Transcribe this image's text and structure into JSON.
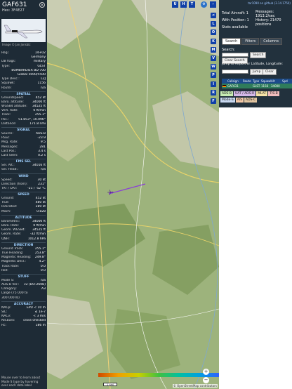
{
  "aircraft": {
    "callsign": "GAF631",
    "hex_label": "Hex:",
    "hex": "3F4E27",
    "photo_credit": "Image © Jan Jonsbiz"
  },
  "details": [
    {
      "type": "row",
      "label": "Reg.:",
      "value": "14+02"
    },
    {
      "type": "row",
      "label": "",
      "value": "Germany"
    },
    {
      "type": "row",
      "label": "DB flags:",
      "value": "military"
    },
    {
      "type": "row",
      "label": "Type:",
      "value": "GLST"
    },
    {
      "type": "row",
      "label": "",
      "value": "BOMBARDIER BD-700"
    },
    {
      "type": "row",
      "label": "",
      "value": "Global 5000/5500"
    },
    {
      "type": "row",
      "label": "Type Desc.:",
      "value": "L2J"
    },
    {
      "type": "row",
      "label": "Squawk:",
      "value": "1156"
    },
    {
      "type": "row",
      "label": "Route:",
      "value": "n/a"
    },
    {
      "type": "section",
      "label": "SPATIAL"
    },
    {
      "type": "row",
      "label": "Groundspeed:",
      "value": "452 kt"
    },
    {
      "type": "row",
      "label": "Baro. altitude:",
      "value": "34000 ft"
    },
    {
      "type": "row",
      "label": "WGS84 altitude:",
      "value": "34525 ft"
    },
    {
      "type": "row",
      "label": "Vert. Rate:",
      "value": "0 ft/min"
    },
    {
      "type": "row",
      "label": "Track:",
      "value": "255.1°"
    },
    {
      "type": "row",
      "label": "Pos.:",
      "value": "51.853°, 10.096°"
    },
    {
      "type": "row",
      "label": "Distance:",
      "value": "171.8 nmi"
    },
    {
      "type": "section",
      "label": "SIGNAL"
    },
    {
      "type": "row",
      "label": "Source:",
      "value": "ADS-B"
    },
    {
      "type": "row",
      "label": "RSSI:",
      "value": "-23.9"
    },
    {
      "type": "row",
      "label": "Msg. Rate:",
      "value": "9.5"
    },
    {
      "type": "row",
      "label": "Messages:",
      "value": "281"
    },
    {
      "type": "row",
      "label": "Last Pos.:",
      "value": "3.4 s"
    },
    {
      "type": "row",
      "label": "Last Seen:",
      "value": "0.2 s"
    },
    {
      "type": "section",
      "label": "FMS SEL"
    },
    {
      "type": "row",
      "label": "Sel. Alt.:",
      "value": "34016 ft"
    },
    {
      "type": "row",
      "label": "Sel. Head.:",
      "value": "n/a"
    },
    {
      "type": "section",
      "label": "WIND"
    },
    {
      "type": "row",
      "label": "Speed:",
      "value": "30 kt"
    },
    {
      "type": "row",
      "label": "Direction (from):",
      "value": "231°"
    },
    {
      "type": "row",
      "label": "TAT / OAT:",
      "value": "-21 / -52 °C"
    },
    {
      "type": "section",
      "label": "SPEED"
    },
    {
      "type": "row",
      "label": "Ground:",
      "value": "452 kt"
    },
    {
      "type": "row",
      "label": "True:",
      "value": "480 kt"
    },
    {
      "type": "row",
      "label": "Indicated:",
      "value": "289 kt"
    },
    {
      "type": "row",
      "label": "Mach:",
      "value": "0.828"
    },
    {
      "type": "section",
      "label": "ALTITUDE"
    },
    {
      "type": "row",
      "label": "Barometric:",
      "value": "34000 ft"
    },
    {
      "type": "row",
      "label": "Baro. Rate:",
      "value": "0 ft/min"
    },
    {
      "type": "row",
      "label": "Geom. WGS84:",
      "value": "34525 ft"
    },
    {
      "type": "row",
      "label": "Geom. Rate:",
      "value": "-32 ft/min"
    },
    {
      "type": "row",
      "label": "QNH:",
      "value": "1012.8 hPa"
    },
    {
      "type": "section",
      "label": "DIRECTION"
    },
    {
      "type": "row",
      "label": "Ground Track:",
      "value": "255.1°"
    },
    {
      "type": "row",
      "label": "True Heading:",
      "value": "253.8°"
    },
    {
      "type": "row",
      "label": "Magnetic Heading:",
      "value": "249.8°"
    },
    {
      "type": "row",
      "label": "Magnetic Decl.:",
      "value": "4.2°"
    },
    {
      "type": "row",
      "label": "Track Rate:",
      "value": "0.0"
    },
    {
      "type": "row",
      "label": "Roll:",
      "value": "0.0"
    },
    {
      "type": "section",
      "label": "STUFF"
    },
    {
      "type": "row",
      "label": "Mode S:",
      "value": "n/a"
    },
    {
      "type": "row",
      "label": "ADS-B Ver.:",
      "value": "v2 (DO-260B)"
    },
    {
      "type": "row",
      "label": "Category:",
      "value": "A3"
    },
    {
      "type": "row",
      "label": "Large (75 000 to",
      "value": ""
    },
    {
      "type": "row",
      "label": "300 000 lb)",
      "value": ""
    },
    {
      "type": "section",
      "label": "ACCURACY"
    },
    {
      "type": "row",
      "label": "NACp:",
      "value": "EPU < 10 m"
    },
    {
      "type": "row",
      "label": "SIL:",
      "value": "≤ 1e-7"
    },
    {
      "type": "row",
      "label": "NACv:",
      "value": "< 3 m/s"
    },
    {
      "type": "row",
      "label": "NICbaro:",
      "value": "cross-checked"
    },
    {
      "type": "row",
      "label": "Rc:",
      "value": "186 m"
    }
  ],
  "footer_text": "Mouse over to learn about Mode S type by hovering over each data label",
  "map": {
    "top_buttons": [
      "U",
      "H",
      "T"
    ],
    "side_buttons": [
      "<",
      "L",
      "O",
      "K",
      "M",
      "V",
      "W",
      "P",
      "I",
      "R",
      "F"
    ],
    "scale_text": "1 nmi",
    "osm_credit": "© OpenStreetMap contributors",
    "zoom_in": "+",
    "zoom_out": "−"
  },
  "right_panel": {
    "top_link": "tar1090 on github (3.14.1750)",
    "total_label": "Total Aircraft: 1",
    "position_label": "With Position: 1",
    "messages_label": "Messages:",
    "messages_value": "1913.2/sec",
    "history_label": "History: 21470",
    "history_sub": "positions",
    "stats_label": "Stats available",
    "tabs": [
      "Search",
      "Filters",
      "Columns"
    ],
    "search_label": "Search:",
    "search_button": "Search",
    "clear_search": "Clear Search",
    "jump_label": "Jump to Airport or Latitude, Longitude:",
    "jump_button": "Jump",
    "clear_button": "Clear",
    "table_headers": [
      "",
      "Callsign",
      "Route",
      "Type",
      "Squawk",
      "Alt",
      "Spd"
    ],
    "table_row": [
      "",
      "GAF631",
      "",
      "GLST",
      "1156",
      "34000",
      ""
    ],
    "tags_row1": [
      "ADS-B",
      "UAT / ADS-R",
      "MLAT",
      "TIS-B"
    ],
    "tags_row2": [
      "Mode-S",
      "AIS",
      "ADS-C"
    ],
    "tag_colors": {
      "ADS-B": "#c7ecb4",
      "UAT / ADS-R": "#d4b8e8",
      "MLAT": "#f5e3a7",
      "TIS-B": "#f0bcbc",
      "Mode-S": "#c8d8f0",
      "AIS": "#f4c9a8",
      "ADS-C": "#e0c4a0"
    }
  }
}
